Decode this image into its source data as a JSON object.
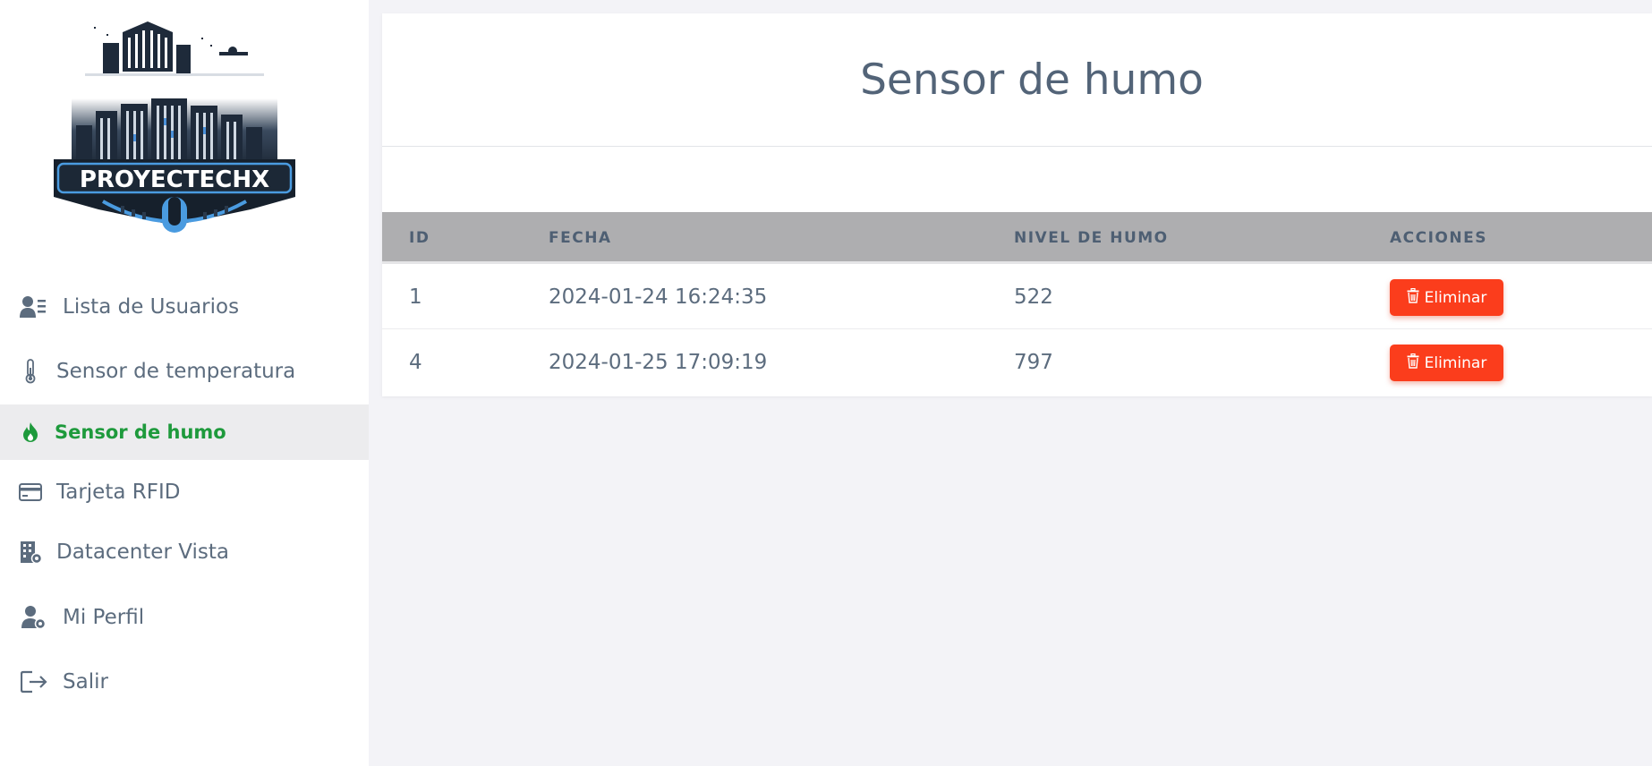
{
  "brand": {
    "logo_text": "PROYECTECHX"
  },
  "sidebar": {
    "items": [
      {
        "label": "Lista de Usuarios",
        "icon": "user-list-icon"
      },
      {
        "label": "Sensor de temperatura",
        "icon": "thermometer-icon"
      },
      {
        "label": "Sensor de humo",
        "icon": "flame-icon",
        "active": true
      },
      {
        "label": "Tarjeta RFID",
        "icon": "credit-card-icon"
      },
      {
        "label": "Datacenter Vista",
        "icon": "building-gear-icon"
      },
      {
        "label": "Mi Perfil",
        "icon": "user-gear-icon"
      },
      {
        "label": "Salir",
        "icon": "logout-icon"
      }
    ]
  },
  "main": {
    "title": "Sensor de humo",
    "table": {
      "headers": [
        "ID",
        "FECHA",
        "NIVEL DE HUMO",
        "ACCIONES"
      ],
      "rows": [
        {
          "id": "1",
          "fecha": "2024-01-24 16:24:35",
          "nivel": "522",
          "action": "Eliminar"
        },
        {
          "id": "4",
          "fecha": "2024-01-25 17:09:19",
          "nivel": "797",
          "action": "Eliminar"
        }
      ]
    }
  },
  "colors": {
    "active_nav": "#1e9a3c",
    "delete_button": "#fb3d1c",
    "table_header_bg": "#aeaeb0",
    "text": "#5c6c7e"
  }
}
